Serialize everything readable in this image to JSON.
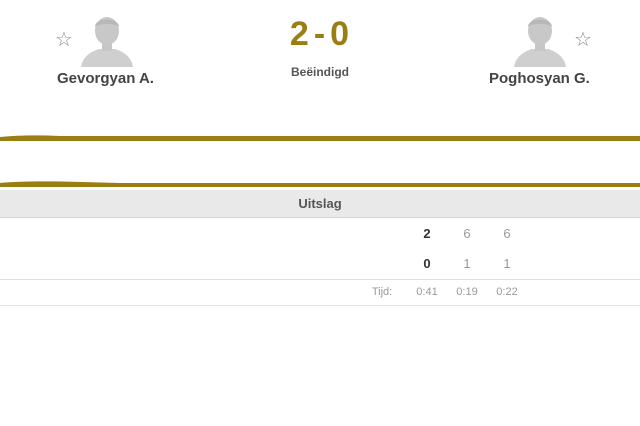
{
  "match": {
    "home": {
      "name": "Gevorgyan A.",
      "favorite_icon": "star-outline-icon",
      "avatar_icon": "player-silhouette-icon"
    },
    "away": {
      "name": "Poghosyan G.",
      "favorite_icon": "star-outline-icon",
      "avatar_icon": "player-silhouette-icon"
    },
    "score": {
      "home": "2",
      "separator": "-",
      "away": "0"
    },
    "status": "Beëindigd",
    "accent_color": "#9a7e12"
  },
  "results": {
    "header": "Uitslag",
    "rows": [
      {
        "total": "2",
        "sets": [
          "6",
          "6"
        ]
      },
      {
        "total": "0",
        "sets": [
          "1",
          "1"
        ]
      }
    ],
    "time_label": "Tijd:",
    "times": [
      "0:41",
      "0:19",
      "0:22"
    ]
  }
}
